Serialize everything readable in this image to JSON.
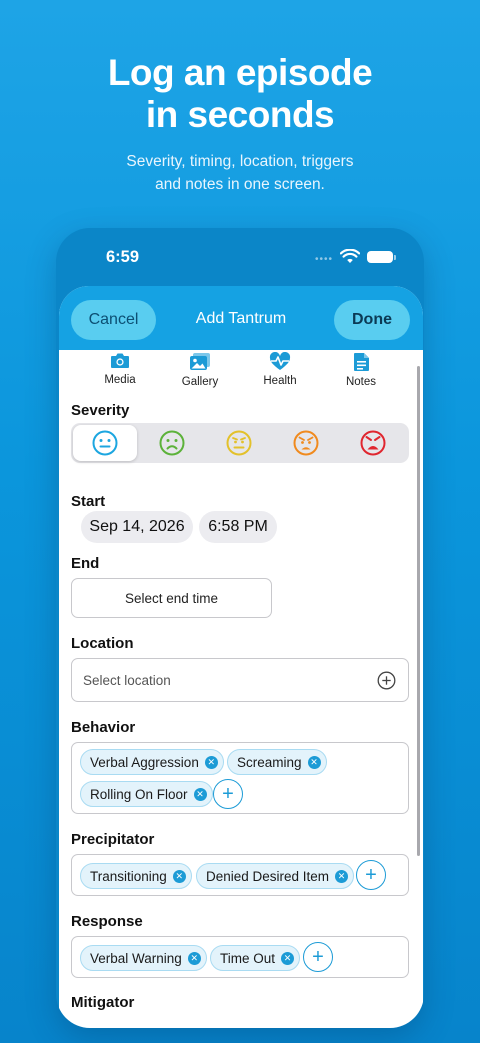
{
  "promo": {
    "headline_line1": "Log an episode",
    "headline_line2": "in seconds",
    "subhead_line1": "Severity, timing, location, triggers",
    "subhead_line2": "and notes in one screen."
  },
  "status_bar": {
    "time": "6:59",
    "dots": "••••"
  },
  "nav": {
    "cancel": "Cancel",
    "title": "Add Tantrum",
    "done": "Done"
  },
  "toolbar": [
    {
      "label": "Media",
      "icon": "camera-icon"
    },
    {
      "label": "Gallery",
      "icon": "gallery-icon"
    },
    {
      "label": "Health",
      "icon": "health-heart-icon"
    },
    {
      "label": "Notes",
      "icon": "notes-icon"
    }
  ],
  "severity": {
    "label": "Severity",
    "selected_index": 0,
    "levels": [
      {
        "icon": "neutral-face-icon",
        "color": "#1ca6e0"
      },
      {
        "icon": "frown-face-icon",
        "color": "#5cb23a"
      },
      {
        "icon": "annoyed-face-icon",
        "color": "#e3c12b"
      },
      {
        "icon": "angry-face-icon",
        "color": "#f08a1e"
      },
      {
        "icon": "furious-face-icon",
        "color": "#e0262f"
      }
    ]
  },
  "start": {
    "label": "Start",
    "date": "Sep 14, 2026",
    "time": "6:58 PM"
  },
  "end": {
    "label": "End",
    "placeholder": "Select end time"
  },
  "location": {
    "label": "Location",
    "placeholder": "Select location"
  },
  "behavior": {
    "label": "Behavior",
    "chips": [
      "Verbal Aggression",
      "Screaming",
      "Rolling On Floor"
    ]
  },
  "precipitator": {
    "label": "Precipitator",
    "chips": [
      "Transitioning",
      "Denied Desired Item"
    ]
  },
  "response": {
    "label": "Response",
    "chips": [
      "Verbal Warning",
      "Time Out"
    ]
  },
  "mitigator": {
    "label": "Mitigator"
  },
  "colors": {
    "accent": "#1c9bd6",
    "background": "#0b96dc",
    "nav": "#15a2e3"
  }
}
